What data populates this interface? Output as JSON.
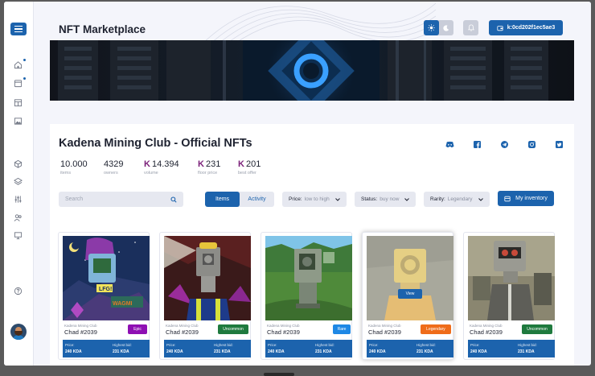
{
  "app": {
    "title": "NFT Marketplace"
  },
  "header": {
    "wallet_address": "k:0cd202f1ec5ae3"
  },
  "collection": {
    "title": "Kadena Mining Club - Official NFTs",
    "currency_symbol": "K",
    "stats": [
      {
        "value": "10.000",
        "label": "items",
        "currency": false
      },
      {
        "value": "4329",
        "label": "owners",
        "currency": false
      },
      {
        "value": "14.394",
        "label": "volume",
        "currency": true
      },
      {
        "value": "231",
        "label": "floor price",
        "currency": true
      },
      {
        "value": "201",
        "label": "best offer",
        "currency": true
      }
    ]
  },
  "controls": {
    "search_placeholder": "Search",
    "tabs": [
      "Items",
      "Activity"
    ],
    "price_filter": {
      "key": "Price:",
      "value": "low to high"
    },
    "status_filter": {
      "key": "Status:",
      "value": "buy now"
    },
    "rarity_filter": {
      "key": "Rarity:",
      "value": "Legendary"
    },
    "inventory_label": "My inventory"
  },
  "cards": [
    {
      "club": "Kadena Mining Club",
      "name": "Chad #2039",
      "rarity": "Epic",
      "rarity_color": "#8e0fb3",
      "price_label": "Price:",
      "price": "240 KDA",
      "bid_label": "Highest bid:",
      "bid": "231 KDA"
    },
    {
      "club": "Kadena Mining Club",
      "name": "Chad #2039",
      "rarity": "Uncommon",
      "rarity_color": "#1f7a3e",
      "price_label": "Price:",
      "price": "240 KDA",
      "bid_label": "Highest bid:",
      "bid": "231 KDA"
    },
    {
      "club": "Kadena Mining Club",
      "name": "Chad #2039",
      "rarity": "Rare",
      "rarity_color": "#1e88e5",
      "price_label": "Price:",
      "price": "240 KDA",
      "bid_label": "Highest bid:",
      "bid": "231 KDA"
    },
    {
      "club": "Kadena Mining Club",
      "name": "Chad #2039",
      "rarity": "Legendary",
      "rarity_color": "#ef6c1a",
      "price_label": "Price:",
      "price": "240 KDA",
      "bid_label": "Highest bid:",
      "bid": "231 KDA",
      "view_label": "View"
    },
    {
      "club": "Kadena Mining Club",
      "name": "Chad #2039",
      "rarity": "Uncommon",
      "rarity_color": "#1f7a3e",
      "price_label": "Price:",
      "price": "240 KDA",
      "bid_label": "Highest bid:",
      "bid": "231 KDA"
    }
  ],
  "colors": {
    "accent": "#1c63ad",
    "currency": "#7a1f78"
  },
  "icons": {
    "sidebar": [
      "home-icon",
      "store-icon",
      "calendar-icon",
      "image-icon",
      "cube-icon",
      "layers-icon",
      "sliders-icon",
      "users-icon",
      "monitor-icon",
      "help-icon"
    ],
    "socials": [
      "discord-icon",
      "facebook-icon",
      "telegram-icon",
      "instagram-icon",
      "twitter-icon"
    ]
  }
}
